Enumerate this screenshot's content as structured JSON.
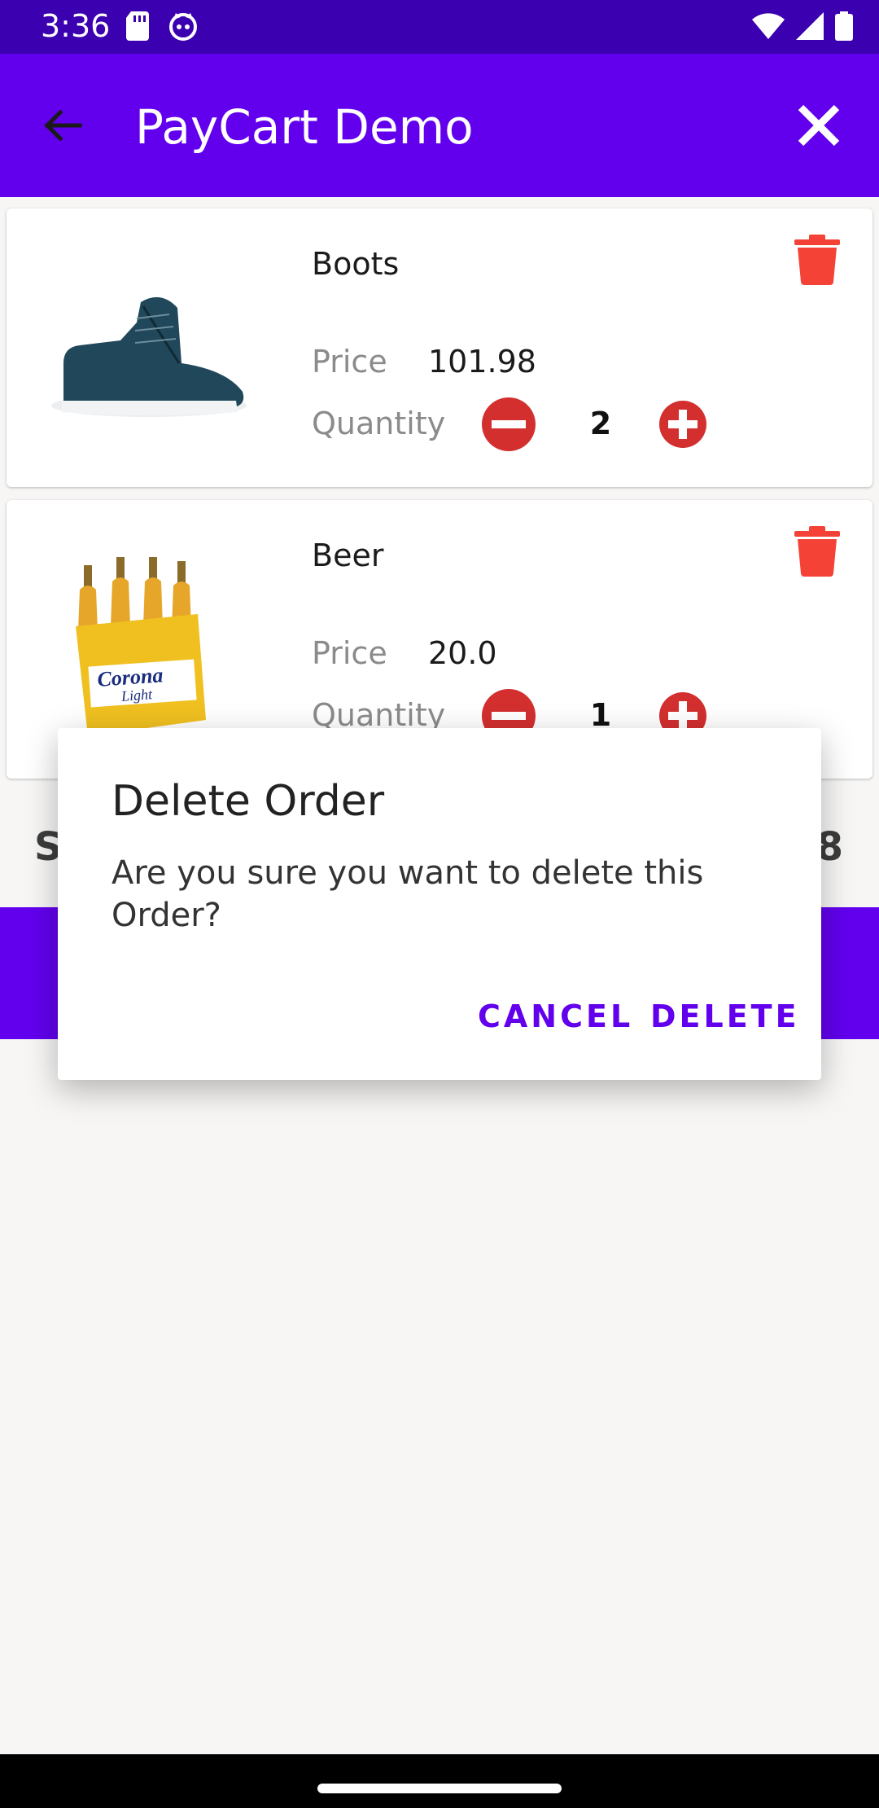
{
  "status_bar": {
    "time": "3:36",
    "icons": [
      "sd-card-icon",
      "cat-face-icon",
      "wifi-icon",
      "signal-icon",
      "battery-icon"
    ]
  },
  "app_bar": {
    "title": "PayCart Demo",
    "back_icon": "arrow-back-icon",
    "close_icon": "close-icon",
    "color": "#6200ee"
  },
  "cart": {
    "items": [
      {
        "name": "Boots",
        "image_icon": "boots-image",
        "price_label": "Price",
        "price": "101.98",
        "quantity_label": "Quantity",
        "quantity": "2"
      },
      {
        "name": "Beer",
        "image_icon": "beer-image",
        "price_label": "Price",
        "price": "20.0",
        "quantity_label": "Quantity",
        "quantity": "1"
      }
    ]
  },
  "summary": {
    "left_fragment": "S",
    "right_fragment": "8"
  },
  "dialog": {
    "title": "Delete Order",
    "message": "Are you sure you want to delete this Order?",
    "cancel_label": "CANCEL",
    "delete_label": "DELETE"
  },
  "colors": {
    "primary": "#6200ee",
    "status_bar": "#3b00b0",
    "delete_red": "#f44336",
    "qty_button_red": "#d32f2f"
  }
}
